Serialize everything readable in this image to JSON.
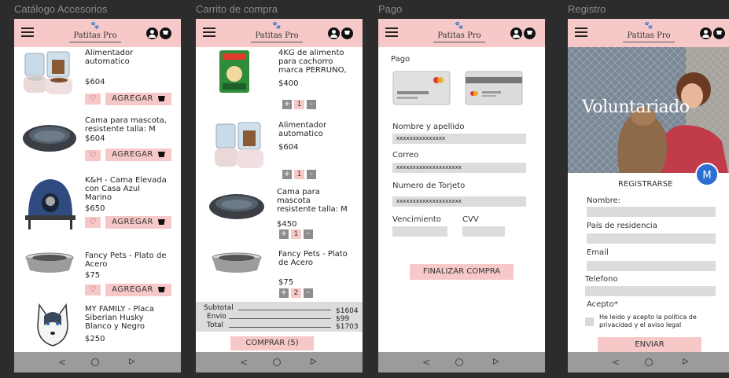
{
  "frames": {
    "catalog_label": "Catálogo Accesorios",
    "cart_label": "Carrito de compra",
    "payment_label": "Pago",
    "register_label": "Registro"
  },
  "app": {
    "brand": "Patitas Pro"
  },
  "nav": {
    "back": "<",
    "recent": "ᐅ"
  },
  "catalog": {
    "add_label": "AGREGAR",
    "products": [
      {
        "name_lines": [
          "Alimentador",
          "automatico"
        ],
        "price": "$604"
      },
      {
        "name_lines": [
          "Cama para mascota,",
          "resistente talla: M"
        ],
        "price": "$604"
      },
      {
        "name_lines": [
          "K&H - Cama Elevada",
          "con Casa Azul",
          "Marino"
        ],
        "price": "$650"
      },
      {
        "name_lines": [
          "Fancy Pets - Plato de",
          "Acero"
        ],
        "price": "$75"
      },
      {
        "name_lines": [
          "MY FAMILY - Placa",
          "Siberian Husky",
          "Blanco y Negro"
        ],
        "price": "$250"
      }
    ]
  },
  "cart": {
    "items": [
      {
        "name_lines": [
          "4KG de alimento",
          "para cachorro",
          "marca PERRUNO,"
        ],
        "price": "$400",
        "qty": "1"
      },
      {
        "name_lines": [
          "Alimentador",
          "automatico"
        ],
        "price": "$604",
        "qty": "1"
      },
      {
        "name_lines": [
          "Cama para",
          "mascota",
          "resistente talla: M"
        ],
        "price": "$450",
        "qty": "1"
      },
      {
        "name_lines": [
          "Fancy Pets - Plato",
          "de Acero"
        ],
        "price": "$75",
        "qty": "2"
      }
    ],
    "minus": "-",
    "plus": "+",
    "subtotal_label": "Subtotal",
    "subtotal_value": "$1604",
    "shipping_label": "Envio",
    "shipping_value": "$99",
    "total_label": "Total",
    "total_value": "$1703",
    "buy_button": "COMPRAR (5)"
  },
  "payment": {
    "title": "Pago",
    "name_label": "Nombre y apellido",
    "name_value": "xxxxxxxxxxxxxxx",
    "email_label": "Correo",
    "email_value": "xxxxxxxxxxxxxxxxxxxx",
    "card_label": "Numero de Torjeto",
    "card_value": "xxxxxxxxxxxxxxxxxxxx",
    "expiry_label": "Vencimiento",
    "cvv_label": "CVV",
    "submit_button": "FINALIZAR COMPRA"
  },
  "register": {
    "hero_title": "Voluntariado",
    "fab_letter": "M",
    "title": "REGISTRARSE",
    "name_label": "Nombre:",
    "country_label": "País de residencia",
    "email_label": "Email",
    "phone_label": "Telefono",
    "accept_label": "Acepto*",
    "terms_lines": [
      "He leido y acepto la  política de",
      "privacidad y el aviso legal"
    ],
    "submit_button": "ENVIAR"
  },
  "colors": {
    "accent": "#f6c8c8",
    "fab": "#2c6fd1",
    "bar": "#9b9b9b"
  }
}
